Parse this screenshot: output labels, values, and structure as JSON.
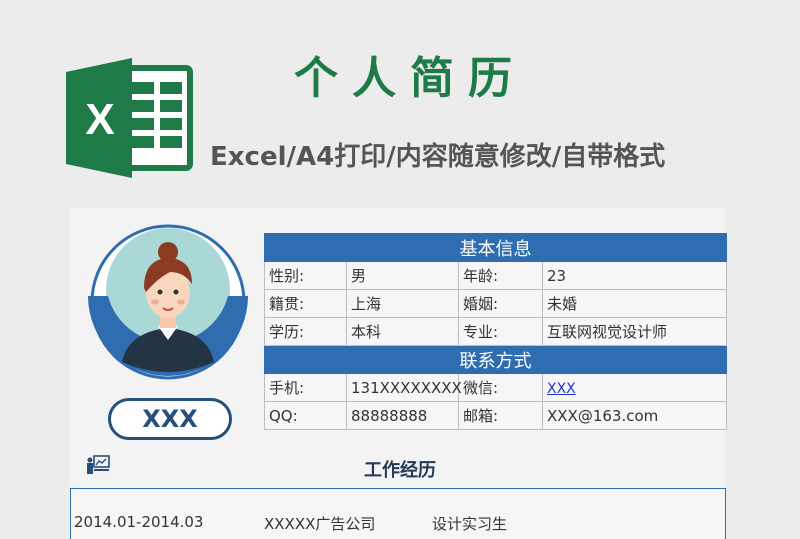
{
  "header": {
    "title": "个人简历",
    "subtitle": "Excel/A4打印/内容随意修改/自带格式",
    "logo_letter": "X",
    "logo_icon": "excel-logo-icon"
  },
  "profile": {
    "name": "XXX",
    "avatar_icon": "person-avatar-icon"
  },
  "basic_info": {
    "heading": "基本信息",
    "rows": [
      {
        "k1": "性别:",
        "v1": "男",
        "k2": "年龄:",
        "v2": "23"
      },
      {
        "k1": "籍贯:",
        "v1": "上海",
        "k2": "婚姻:",
        "v2": "未婚"
      },
      {
        "k1": "学历:",
        "v1": "本科",
        "k2": "专业:",
        "v2": "互联网视觉设计师"
      }
    ]
  },
  "contact": {
    "heading": "联系方式",
    "rows": [
      {
        "k1": "手机:",
        "v1": "131XXXXXXXX",
        "k2": "微信:",
        "v2": "XXX"
      },
      {
        "k1": "QQ:",
        "v1": "88888888",
        "k2": "邮箱:",
        "v2": "XXX@163.com"
      }
    ]
  },
  "work": {
    "heading": "工作经历",
    "icon": "briefcase-presentation-icon",
    "rows": [
      {
        "period": "2014.01-2014.03",
        "company": "XXXXX广告公司",
        "role": "设计实习生"
      }
    ]
  },
  "colors": {
    "brand_green": "#1e7a46",
    "accent_blue": "#2f6db0",
    "dark_blue": "#264f7b"
  }
}
